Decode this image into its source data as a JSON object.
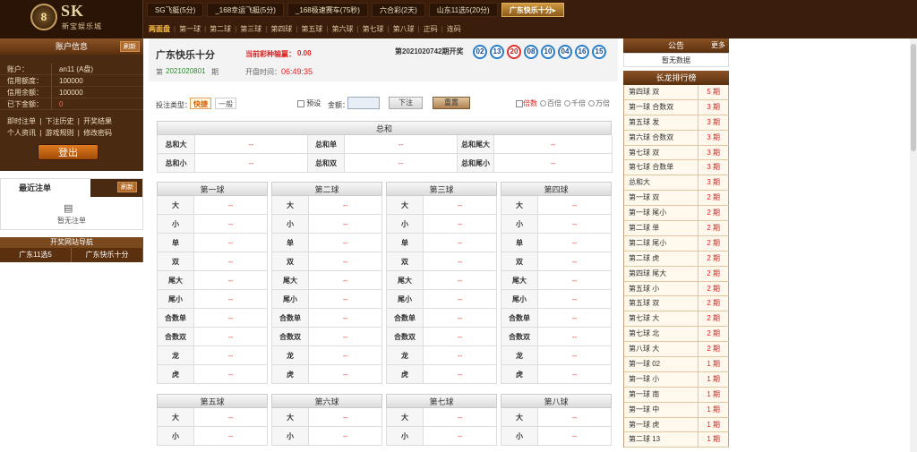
{
  "brand": {
    "logo_text": "SK",
    "logo_badge": "8",
    "logo_subtitle": "新宝娱乐城"
  },
  "game_tabs": [
    "SG飞艇(5分)",
    "_168幸运飞艇(5分)",
    "_168极速赛车(75秒)",
    "六合彩(2天)",
    "山东11选5(20分)",
    "广东快乐十分▸"
  ],
  "active_tab_index": 5,
  "sub_nav": [
    "两面盘",
    "第一球",
    "第二球",
    "第三球",
    "第四球",
    "第五球",
    "第六球",
    "第七球",
    "第八球",
    "正码",
    "连码"
  ],
  "account": {
    "header": "账户信息",
    "refresh": "刷新",
    "rows": [
      {
        "label": "账户：",
        "value": "an11 (A盘)"
      },
      {
        "label": "信用额度：",
        "value": "100000"
      },
      {
        "label": "信用余额：",
        "value": "100000"
      },
      {
        "label": "已下金额：",
        "value": "0"
      }
    ],
    "links_row1": [
      "即时注单",
      "|",
      "下注历史",
      "|",
      "开奖结果"
    ],
    "links_row2": [
      "个人资讯",
      "|",
      "游戏规则",
      "|",
      "修改密码"
    ],
    "logout": "登出"
  },
  "recent": {
    "tab": "最近注单",
    "refresh": "刷新",
    "empty": "暂无注单",
    "icon": "list-icon"
  },
  "nav_sites": {
    "header": "开奖网站导航",
    "links": [
      "广东11选5",
      "广东快乐十分"
    ]
  },
  "game": {
    "name": "广东快乐十分",
    "win_label": "当前彩种输赢：",
    "win_value": "0.00",
    "issue_prefix": "第",
    "issue": "2021020801",
    "issue_suffix": "期",
    "open_label": "开盘时间：",
    "timer": "06:49:35",
    "draw_label": "第2021020742期开奖",
    "balls": [
      "02",
      "13",
      "20",
      "08",
      "10",
      "04",
      "16",
      "15"
    ],
    "red_balls": [
      2
    ]
  },
  "bet": {
    "type_label": "投注类型：",
    "quick": "快捷",
    "normal": "一般",
    "preset": "预设",
    "amount_label": "金额：",
    "amount_value": "",
    "submit": "下注",
    "reset": "重置",
    "multiplier": "倍数",
    "m100": "百倍",
    "m1000": "千倍",
    "m10000": "万倍"
  },
  "sum_section": {
    "title": "总和",
    "rows": [
      [
        {
          "k": "总和大",
          "v": "--"
        },
        {
          "k": "总和单",
          "v": "--"
        },
        {
          "k": "总和尾大",
          "v": "--"
        }
      ],
      [
        {
          "k": "总和小",
          "v": "--"
        },
        {
          "k": "总和双",
          "v": "--"
        },
        {
          "k": "总和尾小",
          "v": "--"
        }
      ]
    ]
  },
  "ball_sections_top": [
    "第一球",
    "第二球",
    "第三球",
    "第四球"
  ],
  "ball_sections_bottom": [
    "第五球",
    "第六球",
    "第七球",
    "第八球"
  ],
  "ball_rows": [
    "大",
    "小",
    "单",
    "双",
    "尾大",
    "尾小",
    "合数单",
    "合数双",
    "龙",
    "虎"
  ],
  "ball_rows_bottom": [
    "大",
    "小"
  ],
  "odds_placeholder": "--",
  "notice": {
    "header": "公告",
    "more": "更多",
    "empty": "暂无数据"
  },
  "dragon": {
    "header": "长龙排行榜",
    "rows": [
      {
        "k": "第四球 双",
        "v": "5 期"
      },
      {
        "k": "第一球 合数双",
        "v": "3 期"
      },
      {
        "k": "第五球 发",
        "v": "3 期"
      },
      {
        "k": "第六球 合数双",
        "v": "3 期"
      },
      {
        "k": "第七球 双",
        "v": "3 期"
      },
      {
        "k": "第七球 合数单",
        "v": "3 期"
      },
      {
        "k": "总和大",
        "v": "3 期"
      },
      {
        "k": "第一球 双",
        "v": "2 期"
      },
      {
        "k": "第一球 尾小",
        "v": "2 期"
      },
      {
        "k": "第二球 单",
        "v": "2 期"
      },
      {
        "k": "第二球 尾小",
        "v": "2 期"
      },
      {
        "k": "第二球 虎",
        "v": "2 期"
      },
      {
        "k": "第四球 尾大",
        "v": "2 期"
      },
      {
        "k": "第五球 小",
        "v": "2 期"
      },
      {
        "k": "第五球 双",
        "v": "2 期"
      },
      {
        "k": "第七球 大",
        "v": "2 期"
      },
      {
        "k": "第七球 北",
        "v": "2 期"
      },
      {
        "k": "第八球 大",
        "v": "2 期"
      },
      {
        "k": "第一球 02",
        "v": "1 期"
      },
      {
        "k": "第一球 小",
        "v": "1 期"
      },
      {
        "k": "第一球 南",
        "v": "1 期"
      },
      {
        "k": "第一球 中",
        "v": "1 期"
      },
      {
        "k": "第一球 虎",
        "v": "1 期"
      },
      {
        "k": "第二球 13",
        "v": "1 期"
      }
    ]
  }
}
